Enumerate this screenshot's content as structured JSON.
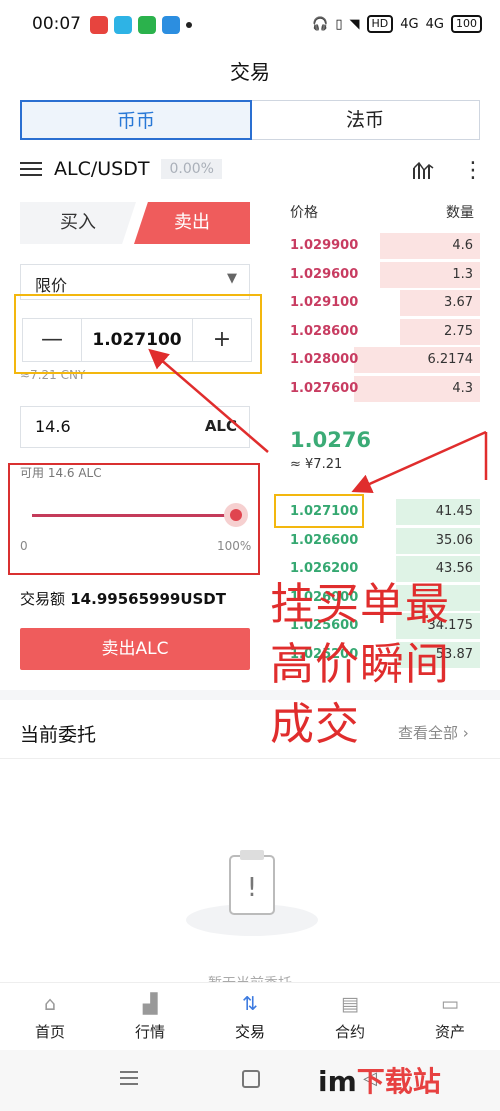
{
  "status_bar": {
    "time": "00:07",
    "network": "4G",
    "network2": "4G",
    "battery": "100",
    "hd": "HD"
  },
  "header": {
    "title": "交易"
  },
  "segments": {
    "coin": "币币",
    "fiat": "法币"
  },
  "pair": {
    "symbol": "ALC/USDT",
    "change": "0.00%"
  },
  "trade_tabs": {
    "buy": "买入",
    "sell": "卖出"
  },
  "order": {
    "type": "限价",
    "price": "1.027100",
    "minus": "—",
    "plus": "+",
    "price_cny": "≈7.21 CNY",
    "amount": "14.6",
    "amount_unit": "ALC",
    "available": "可用 14.6 ALC",
    "slider_min": "0",
    "slider_max": "100%",
    "slider_value": 1.0,
    "volume_label": "交易额",
    "volume_value": "14.99565999USDT",
    "submit": "卖出ALC"
  },
  "orderbook": {
    "price_header": "价格",
    "qty_header": "数量",
    "asks": [
      {
        "price": "1.029900",
        "qty": "4.6",
        "depth": 0.5
      },
      {
        "price": "1.029600",
        "qty": "1.3",
        "depth": 0.5
      },
      {
        "price": "1.029100",
        "qty": "3.67",
        "depth": 0.4
      },
      {
        "price": "1.028600",
        "qty": "2.75",
        "depth": 0.4
      },
      {
        "price": "1.028000",
        "qty": "6.2174",
        "depth": 0.63
      },
      {
        "price": "1.027600",
        "qty": "4.3",
        "depth": 0.63
      }
    ],
    "last_price": "1.0276",
    "last_cny": "≈ ¥7.21",
    "bids": [
      {
        "price": "1.027100",
        "qty": "41.45",
        "depth": 0.42
      },
      {
        "price": "1.026600",
        "qty": "35.06",
        "depth": 0.42
      },
      {
        "price": "1.026200",
        "qty": "43.56",
        "depth": 0.42
      },
      {
        "price": "1.026000",
        "qty": "",
        "depth": 0.42
      },
      {
        "price": "1.025600",
        "qty": "34.175",
        "depth": 0.42
      },
      {
        "price": "1.025200",
        "qty": "53.87",
        "depth": 0.42
      }
    ]
  },
  "annotation": {
    "text": "挂买单最高价瞬间成交"
  },
  "current_orders": {
    "title": "当前委托",
    "view_all": "查看全部",
    "empty": "暂无当前委托"
  },
  "tabbar": [
    {
      "label": "首页",
      "icon": "home-icon"
    },
    {
      "label": "行情",
      "icon": "market-icon"
    },
    {
      "label": "交易",
      "icon": "trade-icon"
    },
    {
      "label": "合约",
      "icon": "contract-icon"
    },
    {
      "label": "资产",
      "icon": "wallet-icon"
    }
  ],
  "watermark": {
    "prefix": "im",
    "suffix": "下载站"
  },
  "colors": {
    "sell": "#ef5c5c",
    "ask_text": "#c83c61",
    "bid_text": "#35a871",
    "accent": "#2a6fd1",
    "annotation": "#e02d2d"
  }
}
